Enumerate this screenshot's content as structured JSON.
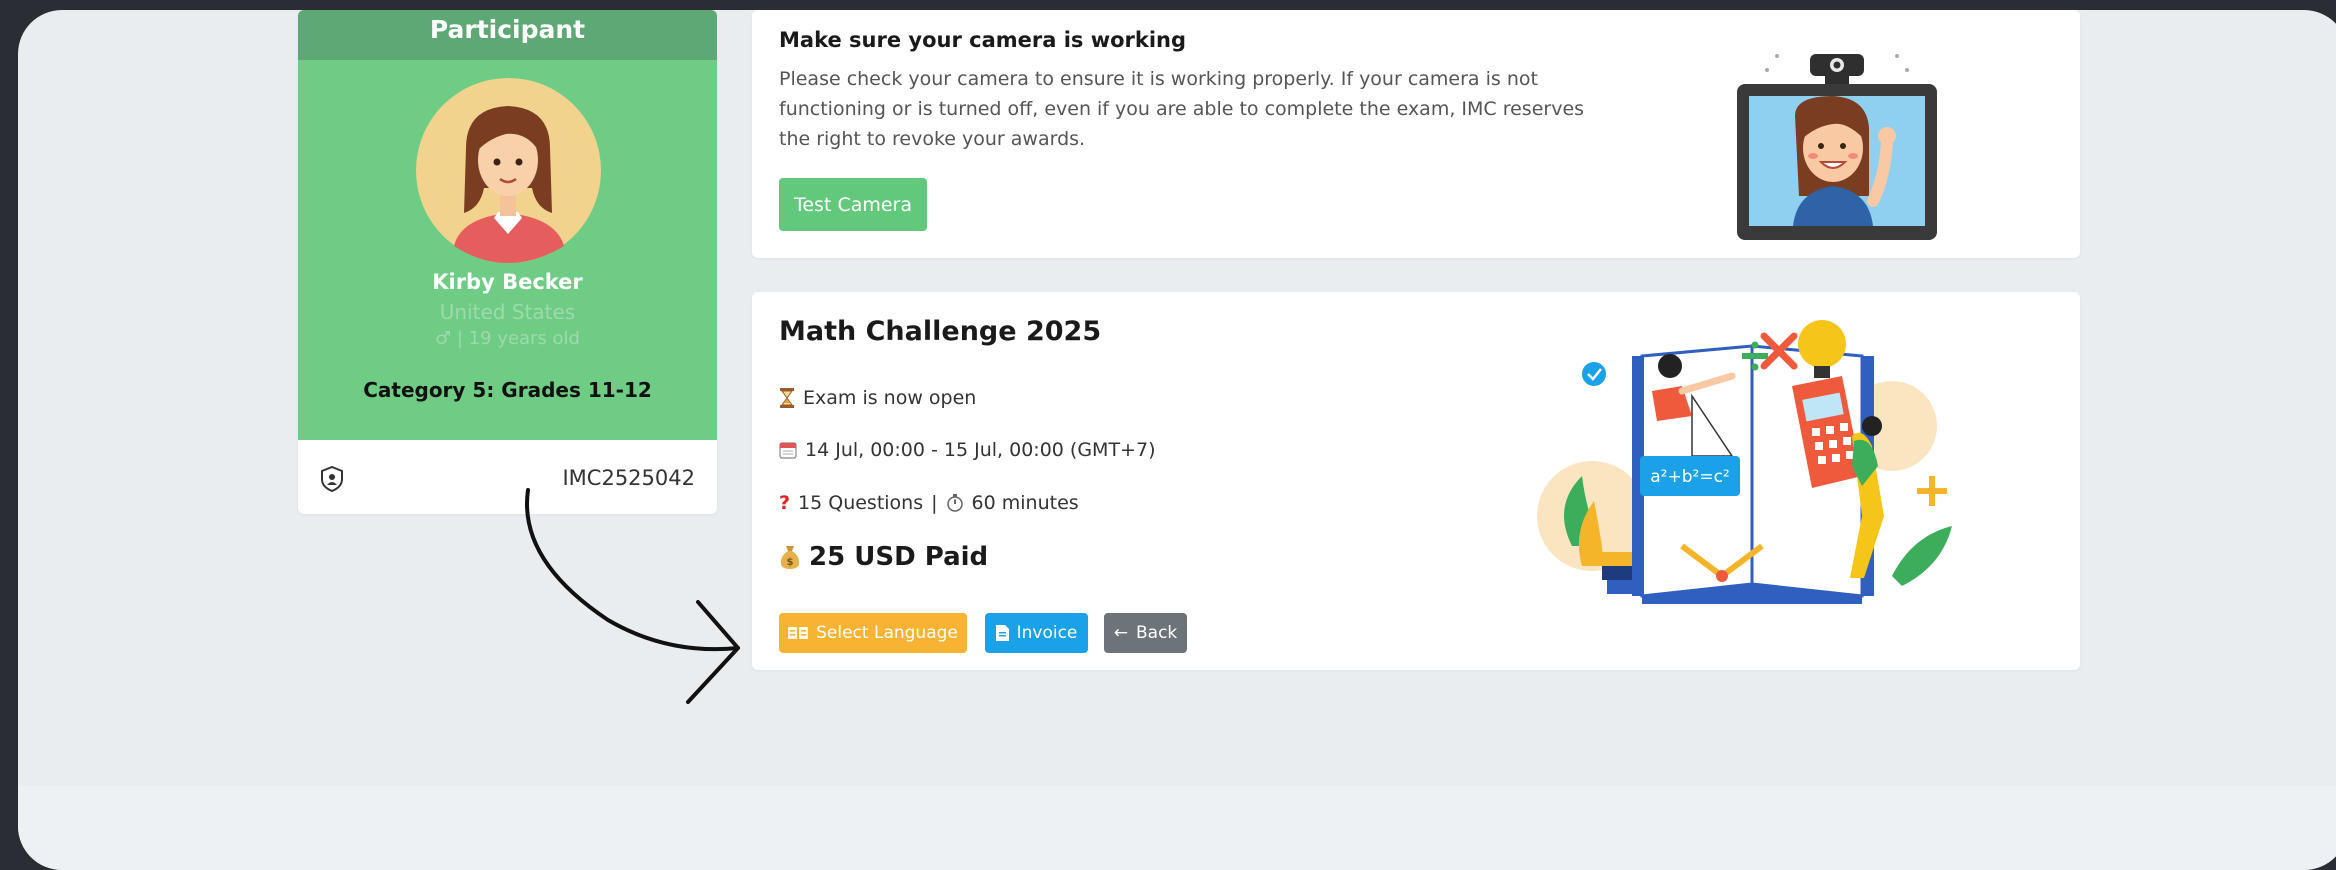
{
  "participant": {
    "header": "Participant",
    "name": "Kirby Becker",
    "country": "United States",
    "gender_age": "♂ | 19 years old",
    "category": "Category 5: Grades 11-12",
    "id": "IMC2525042"
  },
  "camera": {
    "title": "Make sure your camera is working",
    "description": "Please check your camera to ensure it is working properly. If your camera is not functioning or is turned off, even if you are able to complete the exam, IMC reserves the right to revoke your awards.",
    "button": "Test Camera"
  },
  "exam": {
    "title": "Math Challenge 2025",
    "status": "Exam is now open",
    "schedule": "14 Jul, 00:00 - 15 Jul, 00:00 (GMT+7)",
    "questions": "15 Questions",
    "duration": "60 minutes",
    "price": "25 USD Paid",
    "buttons": {
      "language": "Select Language",
      "invoice": "Invoice",
      "back": "Back"
    },
    "formula": "a²+b²=c²"
  },
  "icons": {
    "status": "hourglass-icon",
    "schedule": "calendar-icon",
    "questions": "question-mark-icon",
    "duration": "stopwatch-icon",
    "price": "money-bag-icon"
  },
  "colors": {
    "participant_green": "#6fcc85",
    "test_camera": "#62c87c",
    "select_language": "#f8b333",
    "invoice": "#1aa1e8",
    "back": "#6c7379"
  }
}
